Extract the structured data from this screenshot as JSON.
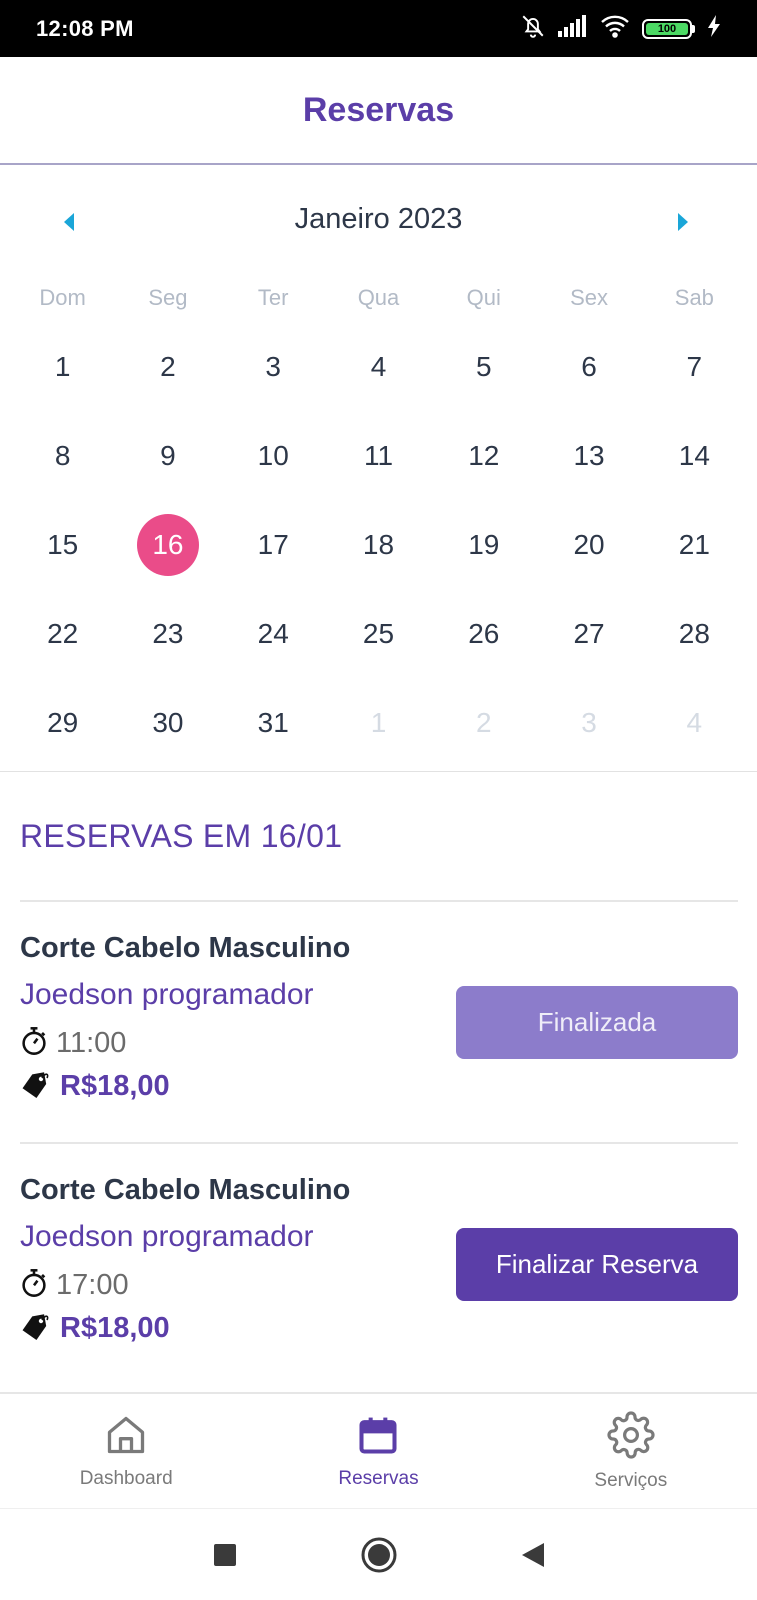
{
  "status_bar": {
    "time": "12:08 PM",
    "battery": "100",
    "icons": [
      "bell-off-icon",
      "signal-icon",
      "wifi-icon",
      "battery-icon",
      "charging-icon"
    ]
  },
  "header": {
    "title": "Reservas"
  },
  "calendar": {
    "month_label": "Janeiro 2023",
    "weekdays": [
      "Dom",
      "Seg",
      "Ter",
      "Qua",
      "Qui",
      "Sex",
      "Sab"
    ],
    "selected_day": "16",
    "accent_color": "#ea4c89",
    "arrow_color": "#1aa6d8",
    "weeks": [
      [
        "1",
        "2",
        "3",
        "4",
        "5",
        "6",
        "7"
      ],
      [
        "8",
        "9",
        "10",
        "11",
        "12",
        "13",
        "14"
      ],
      [
        "15",
        "16",
        "17",
        "18",
        "19",
        "20",
        "21"
      ],
      [
        "22",
        "23",
        "24",
        "25",
        "26",
        "27",
        "28"
      ],
      [
        "29",
        "30",
        "31",
        "1",
        "2",
        "3",
        "4"
      ]
    ]
  },
  "reservations": {
    "section_title": "RESERVAS EM 16/01",
    "items": [
      {
        "service": "Corte Cabelo Masculino",
        "client": "Joedson programador",
        "time": "11:00",
        "price": "R$18,00",
        "button_label": "Finalizada",
        "status": "done"
      },
      {
        "service": "Corte Cabelo Masculino",
        "client": "Joedson programador",
        "time": "17:00",
        "price": "R$18,00",
        "button_label": "Finalizar Reserva",
        "status": "active"
      }
    ]
  },
  "tabbar": {
    "items": [
      {
        "label": "Dashboard",
        "icon": "home-icon",
        "active": false
      },
      {
        "label": "Reservas",
        "icon": "calendar-icon",
        "active": true
      },
      {
        "label": "Serviços",
        "icon": "gear-icon",
        "active": false
      }
    ]
  },
  "colors": {
    "primary": "#5b3ea8",
    "primary_light": "#8c7ccb",
    "text": "#2d3748"
  }
}
